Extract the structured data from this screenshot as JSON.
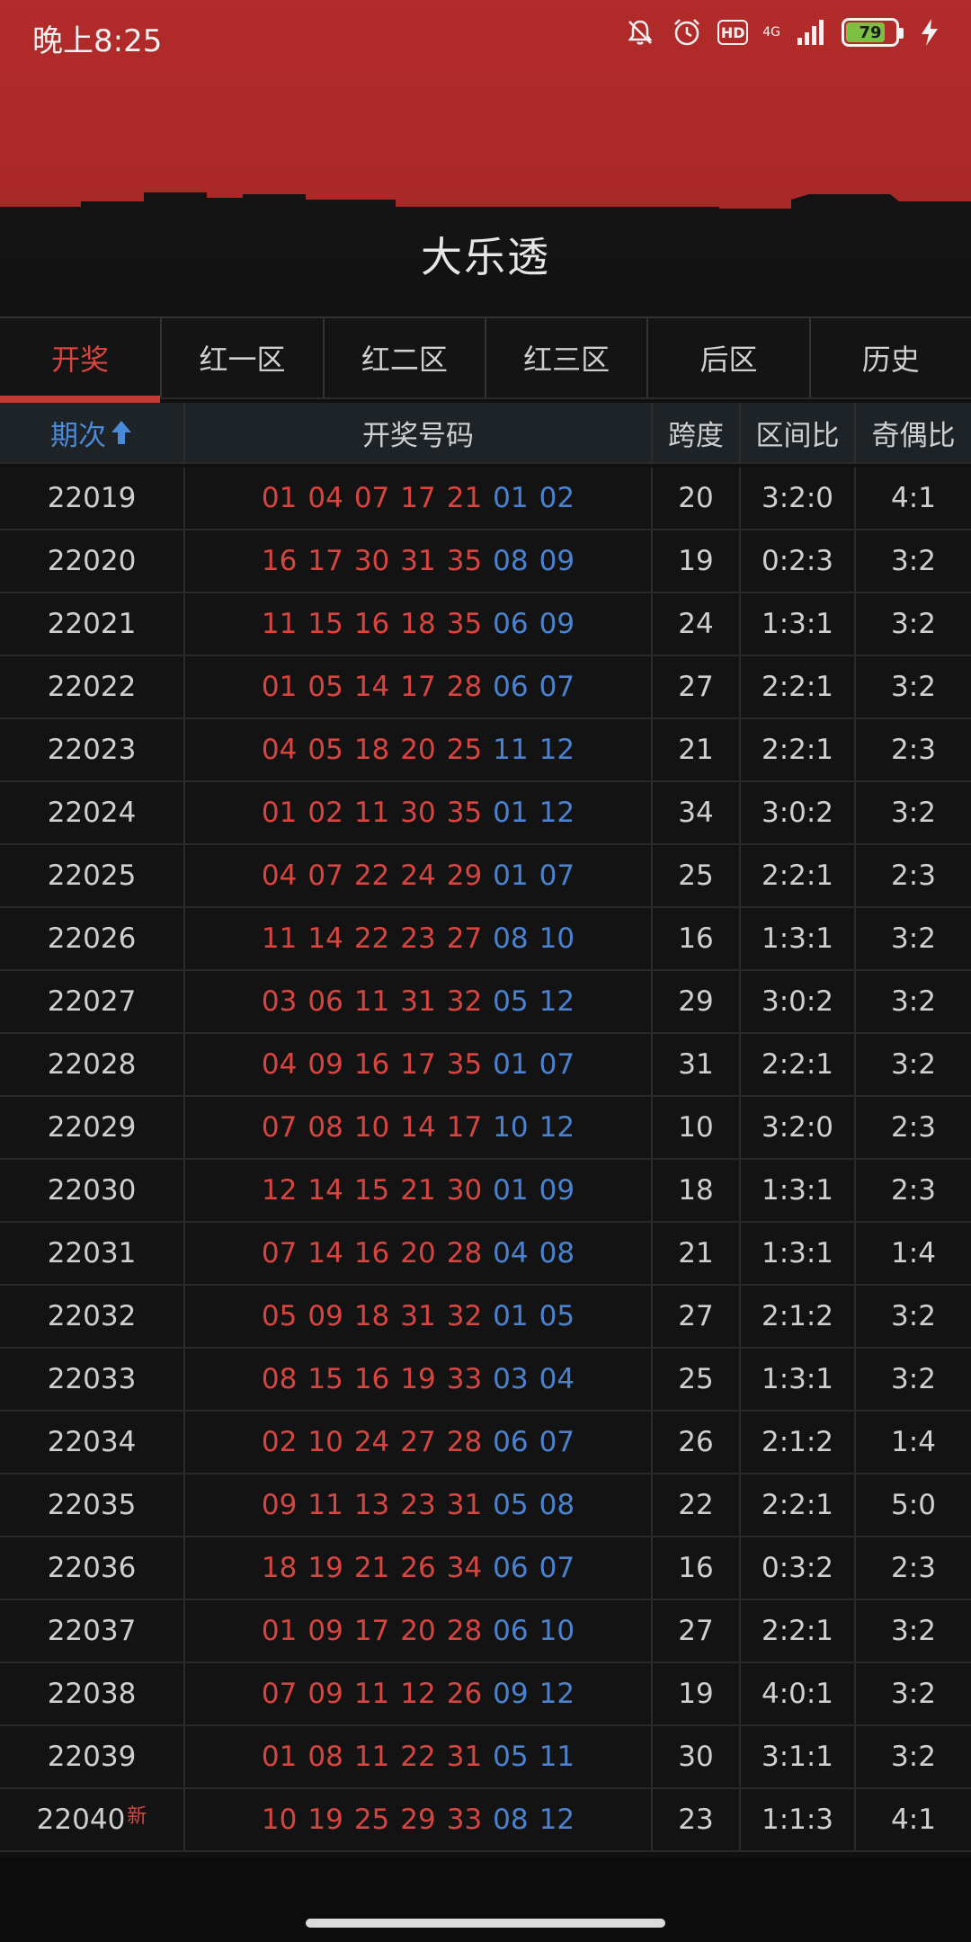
{
  "status": {
    "time": "晚上8:25",
    "network": "4G",
    "hd": "HD",
    "battery": "79",
    "battery_level": 0.79
  },
  "app": {
    "title": "大乐透"
  },
  "tabs": [
    {
      "label": "开奖",
      "active": true
    },
    {
      "label": "红一区",
      "active": false
    },
    {
      "label": "红二区",
      "active": false
    },
    {
      "label": "红三区",
      "active": false
    },
    {
      "label": "后区",
      "active": false
    },
    {
      "label": "历史",
      "active": false
    }
  ],
  "columns": {
    "issue": "期次",
    "numbers": "开奖号码",
    "span": "跨度",
    "zone_ratio": "区间比",
    "odd_even": "奇偶比"
  },
  "new_badge": "新",
  "colors": {
    "red": "#d8443f",
    "blue": "#4a82d0",
    "header_red": "#b32b2b"
  },
  "rows": [
    {
      "issue": "22019",
      "red": [
        "01",
        "04",
        "07",
        "17",
        "21"
      ],
      "blue": [
        "01",
        "02"
      ],
      "span": "20",
      "zone_ratio": "3:2:0",
      "odd_even": "4:1"
    },
    {
      "issue": "22020",
      "red": [
        "16",
        "17",
        "30",
        "31",
        "35"
      ],
      "blue": [
        "08",
        "09"
      ],
      "span": "19",
      "zone_ratio": "0:2:3",
      "odd_even": "3:2"
    },
    {
      "issue": "22021",
      "red": [
        "11",
        "15",
        "16",
        "18",
        "35"
      ],
      "blue": [
        "06",
        "09"
      ],
      "span": "24",
      "zone_ratio": "1:3:1",
      "odd_even": "3:2"
    },
    {
      "issue": "22022",
      "red": [
        "01",
        "05",
        "14",
        "17",
        "28"
      ],
      "blue": [
        "06",
        "07"
      ],
      "span": "27",
      "zone_ratio": "2:2:1",
      "odd_even": "3:2"
    },
    {
      "issue": "22023",
      "red": [
        "04",
        "05",
        "18",
        "20",
        "25"
      ],
      "blue": [
        "11",
        "12"
      ],
      "span": "21",
      "zone_ratio": "2:2:1",
      "odd_even": "2:3"
    },
    {
      "issue": "22024",
      "red": [
        "01",
        "02",
        "11",
        "30",
        "35"
      ],
      "blue": [
        "01",
        "12"
      ],
      "span": "34",
      "zone_ratio": "3:0:2",
      "odd_even": "3:2"
    },
    {
      "issue": "22025",
      "red": [
        "04",
        "07",
        "22",
        "24",
        "29"
      ],
      "blue": [
        "01",
        "07"
      ],
      "span": "25",
      "zone_ratio": "2:2:1",
      "odd_even": "2:3"
    },
    {
      "issue": "22026",
      "red": [
        "11",
        "14",
        "22",
        "23",
        "27"
      ],
      "blue": [
        "08",
        "10"
      ],
      "span": "16",
      "zone_ratio": "1:3:1",
      "odd_even": "3:2"
    },
    {
      "issue": "22027",
      "red": [
        "03",
        "06",
        "11",
        "31",
        "32"
      ],
      "blue": [
        "05",
        "12"
      ],
      "span": "29",
      "zone_ratio": "3:0:2",
      "odd_even": "3:2"
    },
    {
      "issue": "22028",
      "red": [
        "04",
        "09",
        "16",
        "17",
        "35"
      ],
      "blue": [
        "01",
        "07"
      ],
      "span": "31",
      "zone_ratio": "2:2:1",
      "odd_even": "3:2"
    },
    {
      "issue": "22029",
      "red": [
        "07",
        "08",
        "10",
        "14",
        "17"
      ],
      "blue": [
        "10",
        "12"
      ],
      "span": "10",
      "zone_ratio": "3:2:0",
      "odd_even": "2:3"
    },
    {
      "issue": "22030",
      "red": [
        "12",
        "14",
        "15",
        "21",
        "30"
      ],
      "blue": [
        "01",
        "09"
      ],
      "span": "18",
      "zone_ratio": "1:3:1",
      "odd_even": "2:3"
    },
    {
      "issue": "22031",
      "red": [
        "07",
        "14",
        "16",
        "20",
        "28"
      ],
      "blue": [
        "04",
        "08"
      ],
      "span": "21",
      "zone_ratio": "1:3:1",
      "odd_even": "1:4"
    },
    {
      "issue": "22032",
      "red": [
        "05",
        "09",
        "18",
        "31",
        "32"
      ],
      "blue": [
        "01",
        "05"
      ],
      "span": "27",
      "zone_ratio": "2:1:2",
      "odd_even": "3:2"
    },
    {
      "issue": "22033",
      "red": [
        "08",
        "15",
        "16",
        "19",
        "33"
      ],
      "blue": [
        "03",
        "04"
      ],
      "span": "25",
      "zone_ratio": "1:3:1",
      "odd_even": "3:2"
    },
    {
      "issue": "22034",
      "red": [
        "02",
        "10",
        "24",
        "27",
        "28"
      ],
      "blue": [
        "06",
        "07"
      ],
      "span": "26",
      "zone_ratio": "2:1:2",
      "odd_even": "1:4"
    },
    {
      "issue": "22035",
      "red": [
        "09",
        "11",
        "13",
        "23",
        "31"
      ],
      "blue": [
        "05",
        "08"
      ],
      "span": "22",
      "zone_ratio": "2:2:1",
      "odd_even": "5:0"
    },
    {
      "issue": "22036",
      "red": [
        "18",
        "19",
        "21",
        "26",
        "34"
      ],
      "blue": [
        "06",
        "07"
      ],
      "span": "16",
      "zone_ratio": "0:3:2",
      "odd_even": "2:3"
    },
    {
      "issue": "22037",
      "red": [
        "01",
        "09",
        "17",
        "20",
        "28"
      ],
      "blue": [
        "06",
        "10"
      ],
      "span": "27",
      "zone_ratio": "2:2:1",
      "odd_even": "3:2"
    },
    {
      "issue": "22038",
      "red": [
        "07",
        "09",
        "11",
        "12",
        "26"
      ],
      "blue": [
        "09",
        "12"
      ],
      "span": "19",
      "zone_ratio": "4:0:1",
      "odd_even": "3:2"
    },
    {
      "issue": "22039",
      "red": [
        "01",
        "08",
        "11",
        "22",
        "31"
      ],
      "blue": [
        "05",
        "11"
      ],
      "span": "30",
      "zone_ratio": "3:1:1",
      "odd_even": "3:2"
    },
    {
      "issue": "22040",
      "red": [
        "10",
        "19",
        "25",
        "29",
        "33"
      ],
      "blue": [
        "08",
        "12"
      ],
      "span": "23",
      "zone_ratio": "1:1:3",
      "odd_even": "4:1",
      "is_new": true
    }
  ]
}
